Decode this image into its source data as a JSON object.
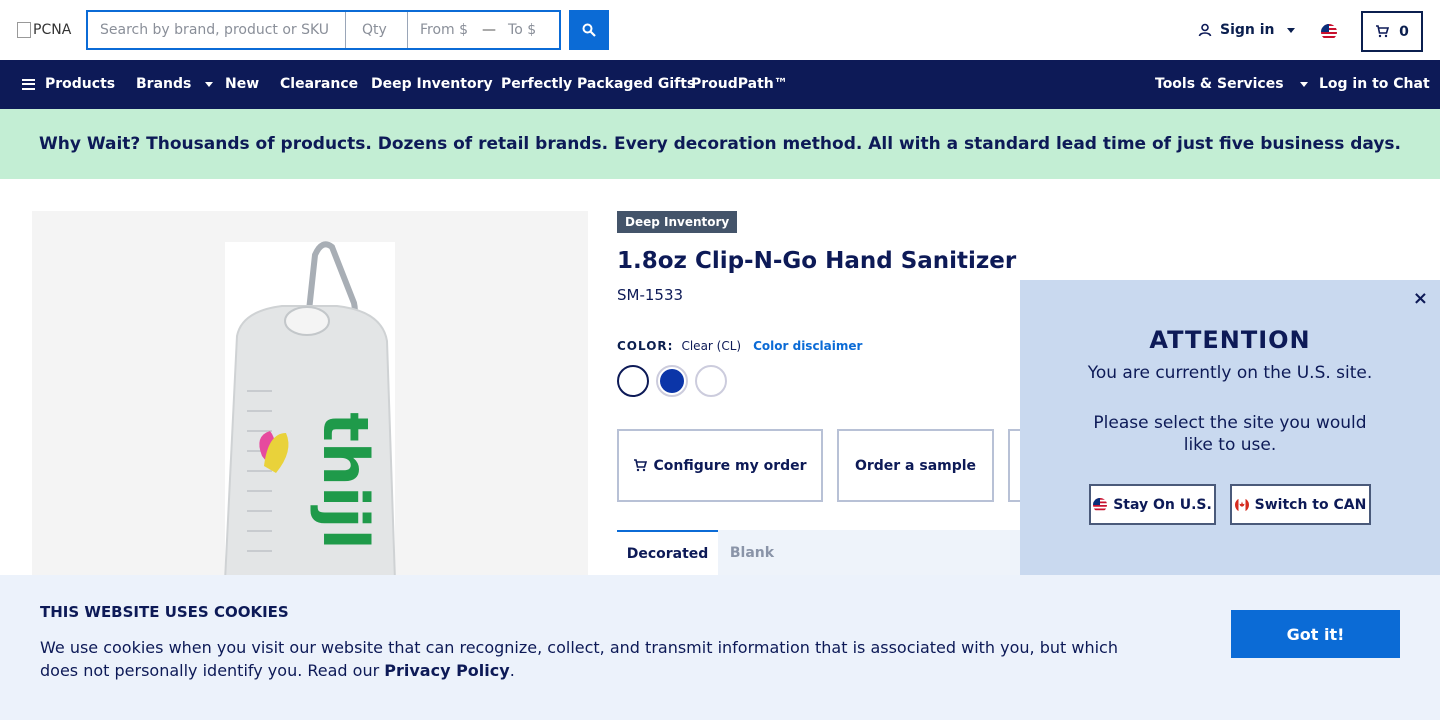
{
  "header": {
    "logo_alt": "PCNA",
    "search_placeholder": "Search by brand, product or SKU",
    "qty_placeholder": "Qty",
    "from_placeholder": "From $",
    "range_dash": "—",
    "to_placeholder": "To $",
    "signin_label": "Sign in",
    "cart_count": "0"
  },
  "nav": {
    "products": "Products",
    "brands": "Brands",
    "new": "New",
    "clearance": "Clearance",
    "deep_inventory": "Deep Inventory",
    "gifts": "Perfectly Packaged Gifts",
    "proudpath": "ProudPath™",
    "tools": "Tools & Services",
    "chat": "Log in to Chat"
  },
  "banner": {
    "text": "Why Wait? Thousands of products. Dozens of retail brands. Every decoration method. All with a standard lead time of just five business days."
  },
  "product": {
    "badge": "Deep Inventory",
    "title": "1.8oz Clip-N-Go Hand Sanitizer",
    "sku": "SM-1533",
    "color_label": "COLOR:",
    "color_value": "Clear (CL)",
    "color_disclaimer": "Color disclaimer",
    "swatches": [
      "#ffffff",
      "#0b35a8",
      "#ffffff"
    ],
    "configure_label": "Configure my order",
    "sample_label": "Order a sample",
    "tabs": [
      "Decorated",
      "Blank"
    ],
    "image_brand_text": "thijl"
  },
  "popup": {
    "close": "×",
    "heading": "ATTENTION",
    "current": "You are currently on the U.S. site.",
    "select": "Please select the site you would like to use.",
    "stay_label": "Stay On U.S.",
    "switch_label": "Switch to CAN"
  },
  "cookie": {
    "heading": "THIS WEBSITE USES COOKIES",
    "text_before": "We use cookies when you visit our website that can recognize, collect, and transmit information that is associated with you, but which does not personally identify you. Read our ",
    "policy_link": "Privacy Policy",
    "text_after": ".",
    "accept_label": "Got it!"
  },
  "colors": {
    "navy": "#0d1a57",
    "accent_blue": "#0b6bd6",
    "banner_green": "#c3eed4",
    "popup_bg": "#c9d9ef",
    "cookie_bg": "#ecf2fb"
  }
}
